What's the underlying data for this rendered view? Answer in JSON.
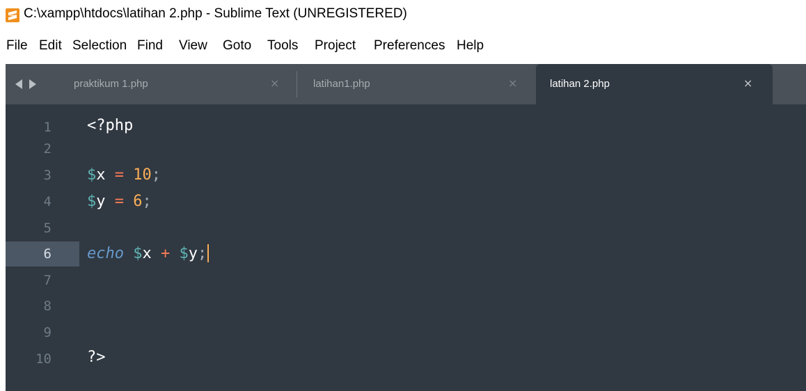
{
  "window": {
    "title": "C:\\xampp\\htdocs\\latihan 2.php - Sublime Text (UNREGISTERED)",
    "accent_color": "#f08f1d"
  },
  "menu": [
    "File",
    "Edit",
    "Selection",
    "Find",
    "View",
    "Goto",
    "Tools",
    "Project",
    "Preferences",
    "Help"
  ],
  "tabs": [
    {
      "label": "praktikum 1.php",
      "close": "×",
      "active": false
    },
    {
      "label": "latihan1.php",
      "close": "×",
      "active": false
    },
    {
      "label": "latihan 2.php",
      "close": "×",
      "active": true
    }
  ],
  "editor": {
    "current_line": 6,
    "line_numbers": [
      "1",
      "2",
      "3",
      "4",
      "5",
      "6",
      "7",
      "8",
      "9",
      "10"
    ],
    "tokens": {
      "l1_tag": "<?php",
      "l3_dollar": "$",
      "l3_name": "x",
      "l3_eq": "=",
      "l3_num": "10",
      "l3_semi": ";",
      "l4_dollar": "$",
      "l4_name": "y",
      "l4_eq": "=",
      "l4_num": "6",
      "l4_semi": ";",
      "l6_echo": "echo",
      "l6_dollar1": "$",
      "l6_name1": "x",
      "l6_plus": "+",
      "l6_dollar2": "$",
      "l6_name2": "y",
      "l6_semi": ";",
      "l10_tag": "?>"
    }
  }
}
